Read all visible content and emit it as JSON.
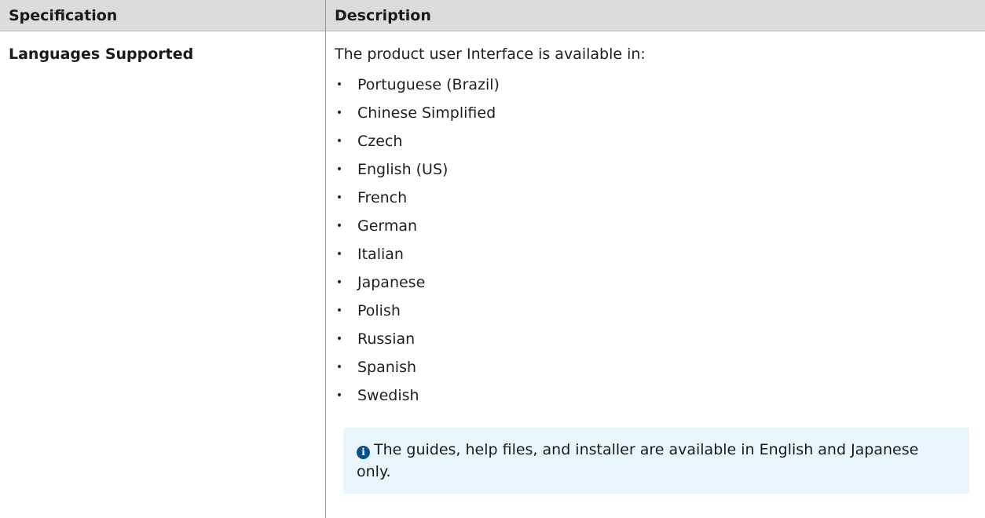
{
  "table": {
    "headers": {
      "specification": "Specification",
      "description": "Description"
    },
    "row": {
      "spec": "Languages Supported",
      "intro": "The product user Interface is available in:",
      "languages": [
        "Portuguese (Brazil)",
        "Chinese Simplified",
        "Czech",
        "English (US)",
        "French",
        "German",
        "Italian",
        "Japanese",
        "Polish",
        "Russian",
        "Spanish",
        "Swedish"
      ],
      "bullet": "•",
      "note": {
        "icon": "info-icon",
        "icon_glyph": "i",
        "text": "The guides, help files, and installer are available in English and Japanese only."
      }
    }
  },
  "colors": {
    "header_bg": "#dcdcdc",
    "note_bg": "#e8f5fd",
    "info_icon": "#0b4f8a"
  }
}
